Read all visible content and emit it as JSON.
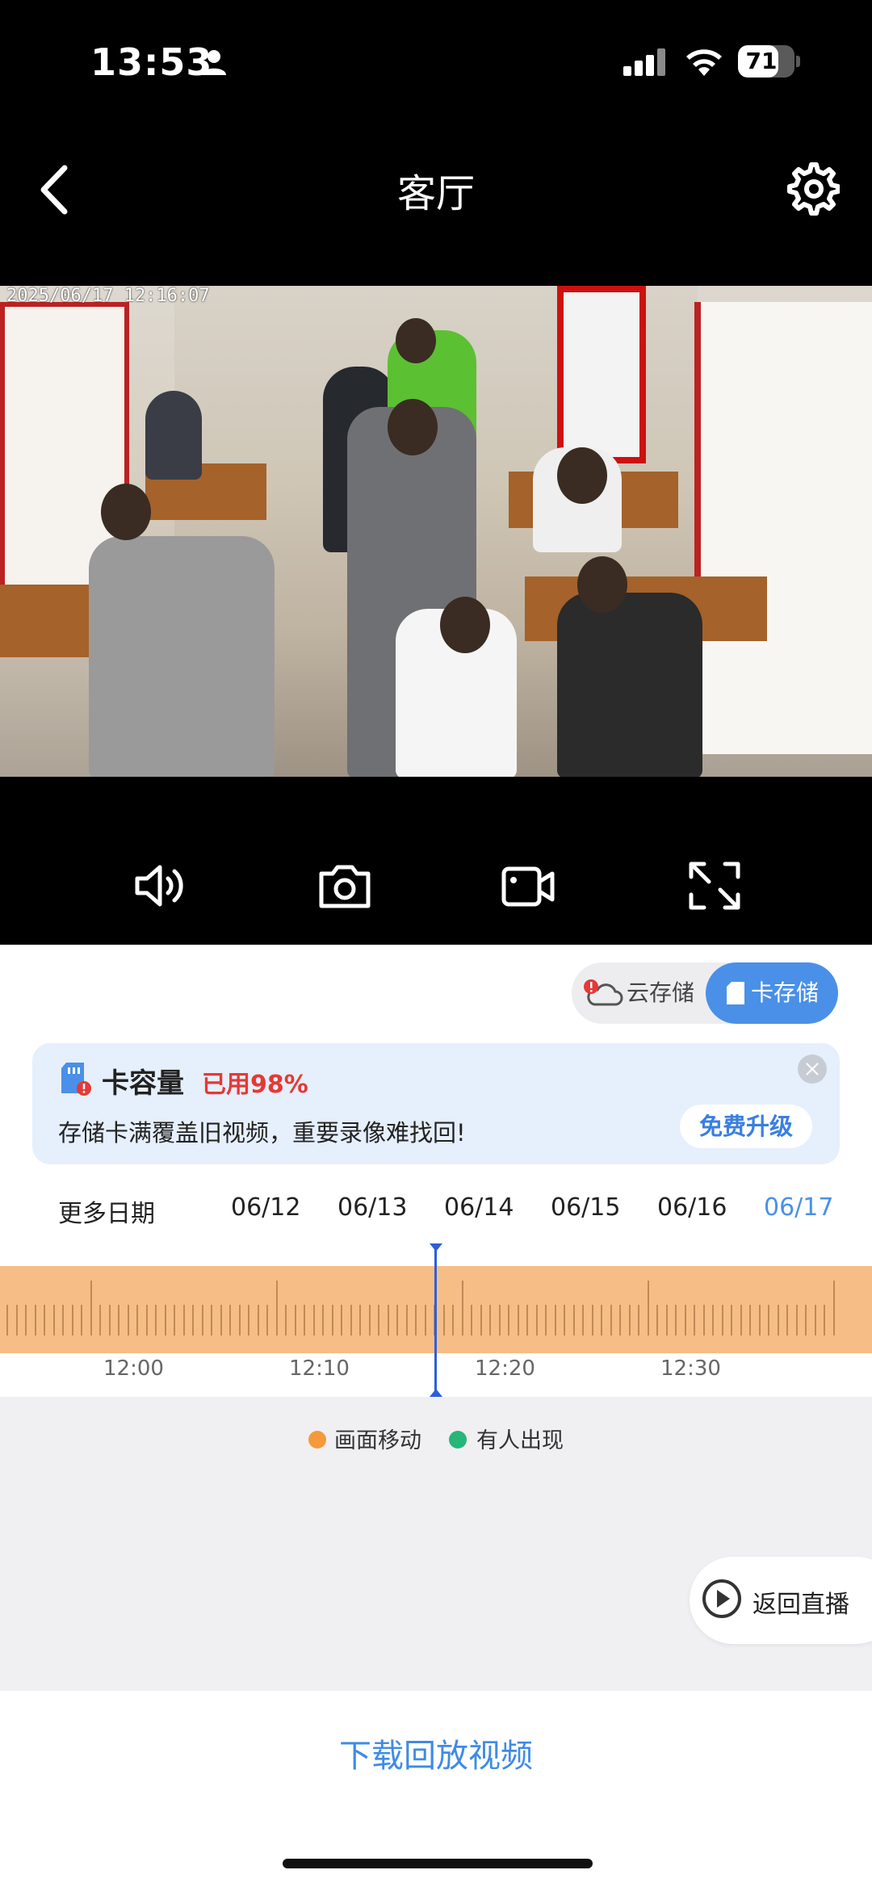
{
  "status_bar": {
    "time": "13:53",
    "battery": "71",
    "battery_level": 0.71
  },
  "header": {
    "title": "客厅"
  },
  "video": {
    "timestamp": "2025/06/17 12:16:07"
  },
  "storage_toggle": {
    "cloud_label": "云存储",
    "card_label": "卡存储",
    "active": "card"
  },
  "notice": {
    "title": "卡容量",
    "used": "已用98%",
    "message": "存储卡满覆盖旧视频，重要录像难找回!",
    "upgrade_label": "免费升级"
  },
  "dates": {
    "more_label": "更多日期",
    "items": [
      "06/12",
      "06/13",
      "06/14",
      "06/15",
      "06/16",
      "06/17"
    ],
    "selected": "06/17"
  },
  "timeline": {
    "labels": [
      "12:00",
      "12:10",
      "12:20",
      "12:30"
    ]
  },
  "legend": {
    "items": [
      {
        "label": "画面移动",
        "color": "#f59a3b"
      },
      {
        "label": "有人出现",
        "color": "#27b57a"
      }
    ]
  },
  "live_button": {
    "label": "返回直播"
  },
  "download": {
    "label": "下载回放视频"
  },
  "colors": {
    "accent": "#4a90e8",
    "warning": "#e53935",
    "timeline": "#f6be86"
  }
}
